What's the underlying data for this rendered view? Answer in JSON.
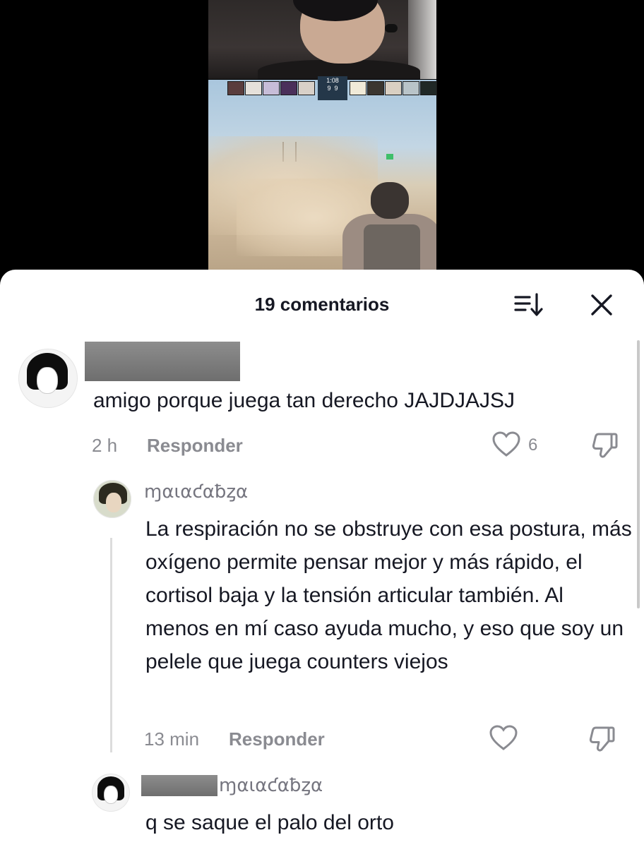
{
  "sheet": {
    "title": "19 comentarios"
  },
  "video": {
    "hud": {
      "timer": "1:08",
      "score_left": "9",
      "score_right": "9"
    }
  },
  "comments": [
    {
      "username": "",
      "text": "amigo porque juega tan derecho JAJDJAJSJ",
      "time": "2 h",
      "reply_label": "Responder",
      "likes": "6"
    },
    {
      "username": "ɱαɩαƈαƀȥα",
      "text": "La respiración no se obstruye con esa postura, más oxígeno permite pensar mejor y más rápido, el cortisol baja y la tensión articular también. Al menos en mí caso ayuda mucho, y eso que soy un pelele que juega counters viejos",
      "time": "13 min",
      "reply_label": "Responder"
    },
    {
      "reply_to": "ɱαɩαƈαƀȥα",
      "text": "q se saque el palo del orto"
    }
  ],
  "icons": {
    "sort": "sort-icon",
    "close": "close-icon",
    "heart": "heart-icon",
    "dislike": "dislike-icon"
  },
  "colors": {
    "text_primary": "#161823",
    "text_secondary": "#8a8b91"
  }
}
